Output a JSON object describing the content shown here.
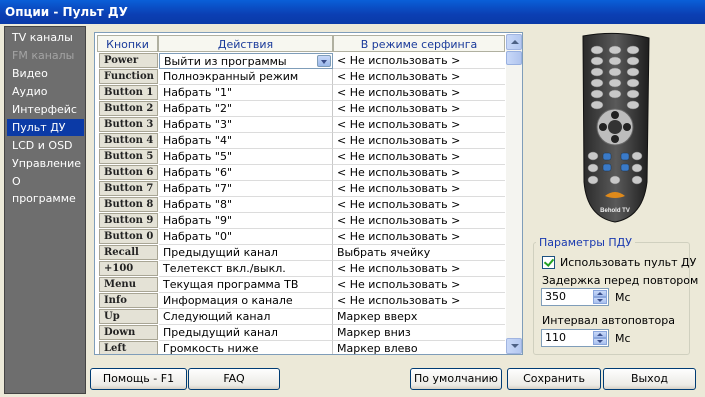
{
  "window": {
    "title": "Опции - Пульт ДУ"
  },
  "sidebar": {
    "items": [
      {
        "label": "TV каналы",
        "state": "normal"
      },
      {
        "label": "FM каналы",
        "state": "disabled"
      },
      {
        "label": "Видео",
        "state": "normal"
      },
      {
        "label": "Аудио",
        "state": "normal"
      },
      {
        "label": "Интерфейс",
        "state": "normal"
      },
      {
        "label": "Пульт ДУ",
        "state": "selected"
      },
      {
        "label": "LCD и OSD",
        "state": "normal"
      },
      {
        "label": "Управление",
        "state": "normal"
      },
      {
        "label": "О программе",
        "state": "normal"
      }
    ]
  },
  "table": {
    "headers": {
      "key": "Кнопки",
      "action": "Действия",
      "surf": "В режиме серфинга"
    },
    "rows": [
      {
        "key": "Power",
        "action": "Выйти из программы",
        "surf": "< Не использовать >"
      },
      {
        "key": "Function",
        "action": "Полноэкранный режим",
        "surf": "< Не использовать >"
      },
      {
        "key": "Button 1",
        "action": "Набрать \"1\"",
        "surf": "< Не использовать >"
      },
      {
        "key": "Button 2",
        "action": "Набрать \"2\"",
        "surf": "< Не использовать >"
      },
      {
        "key": "Button 3",
        "action": "Набрать \"3\"",
        "surf": "< Не использовать >"
      },
      {
        "key": "Button 4",
        "action": "Набрать \"4\"",
        "surf": "< Не использовать >"
      },
      {
        "key": "Button 5",
        "action": "Набрать \"5\"",
        "surf": "< Не использовать >"
      },
      {
        "key": "Button 6",
        "action": "Набрать \"6\"",
        "surf": "< Не использовать >"
      },
      {
        "key": "Button 7",
        "action": "Набрать \"7\"",
        "surf": "< Не использовать >"
      },
      {
        "key": "Button 8",
        "action": "Набрать \"8\"",
        "surf": "< Не использовать >"
      },
      {
        "key": "Button 9",
        "action": "Набрать \"9\"",
        "surf": "< Не использовать >"
      },
      {
        "key": "Button 0",
        "action": "Набрать \"0\"",
        "surf": "< Не использовать >"
      },
      {
        "key": "Recall",
        "action": "Предыдущий канал",
        "surf": "Выбрать ячейку"
      },
      {
        "key": "+100",
        "action": "Телетекст вкл./выкл.",
        "surf": "< Не использовать >"
      },
      {
        "key": "Menu",
        "action": "Текущая программа ТВ",
        "surf": "< Не использовать >"
      },
      {
        "key": "Info",
        "action": "Информация о канале",
        "surf": "< Не использовать >"
      },
      {
        "key": "Up",
        "action": "Следующий канал",
        "surf": "Маркер вверх"
      },
      {
        "key": "Down",
        "action": "Предыдущий канал",
        "surf": "Маркер вниз"
      },
      {
        "key": "Left",
        "action": "Громкость ниже",
        "surf": "Маркер влево"
      }
    ]
  },
  "remote": {
    "brand": "Behold TV"
  },
  "params": {
    "title": "Параметры ПДУ",
    "use_remote_label": "Использовать пульт ДУ",
    "use_remote_checked": true,
    "delay_label": "Задержка перед повтором",
    "delay_value": "350",
    "delay_unit": "Мс",
    "interval_label": "Интервал автоповтора",
    "interval_value": "110",
    "interval_unit": "Мс"
  },
  "buttons": {
    "help": "Помощь - F1",
    "faq": "FAQ",
    "defaults": "По умолчанию",
    "save": "Сохранить",
    "exit": "Выход"
  }
}
